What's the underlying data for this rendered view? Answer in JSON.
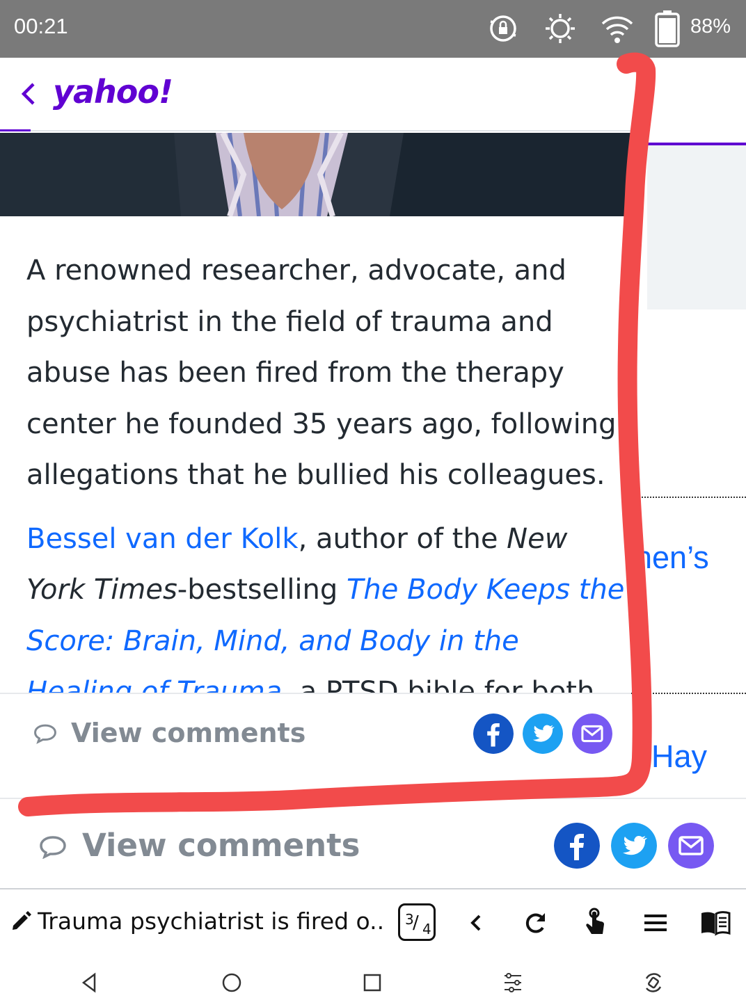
{
  "status_bar": {
    "time": "00:21",
    "icons": [
      "rotation-lock-icon",
      "brightness-icon",
      "wifi-icon",
      "battery-icon"
    ],
    "battery_percent": "88%"
  },
  "header": {
    "back_icon": "chevron-left-icon",
    "logo": "yahoo!",
    "brand_color": "#6001d2"
  },
  "article": {
    "paragraph_1": "A renowned researcher, advocate, and psychiatrist in the field of trauma and abuse has been fired from the therapy center he founded 35 years ago, following allegations that he bullied his colleagues.",
    "author_link": "Bessel van der Kolk",
    "text_after_author": ", author of the ",
    "publication": "New York Times",
    "text_bestselling": "-bestselling ",
    "book_link": "The Body Keeps the Score: Brain, Mind, and Body in the Healing of Trauma",
    "text_after_book": ", a PTSD bible for both",
    "link_color": "#0f69ff"
  },
  "background_page": {
    "fragment_1": "nen’s",
    "fragment_2": "Hay"
  },
  "comment_bar": {
    "label": "View comments",
    "share_icons": [
      "facebook-icon",
      "twitter-icon",
      "mail-icon"
    ],
    "facebook_color": "#1455c4",
    "twitter_color": "#1da1f2",
    "mail_color": "#7759f2"
  },
  "comment_bar_2": {
    "label": "View comments"
  },
  "toolbar": {
    "title": "Trauma psychiatrist is fired o...",
    "page_current": "3",
    "page_total": "4",
    "icons": [
      "edit-icon",
      "back-icon",
      "refresh-icon",
      "touch-icon",
      "menu-icon",
      "reader-icon"
    ]
  },
  "nav_bar": {
    "icons": [
      "nav-back-icon",
      "nav-home-icon",
      "nav-recents-icon",
      "settings-sliders-icon",
      "rotate-icon"
    ]
  },
  "annotation": {
    "color": "#f24b4b"
  }
}
